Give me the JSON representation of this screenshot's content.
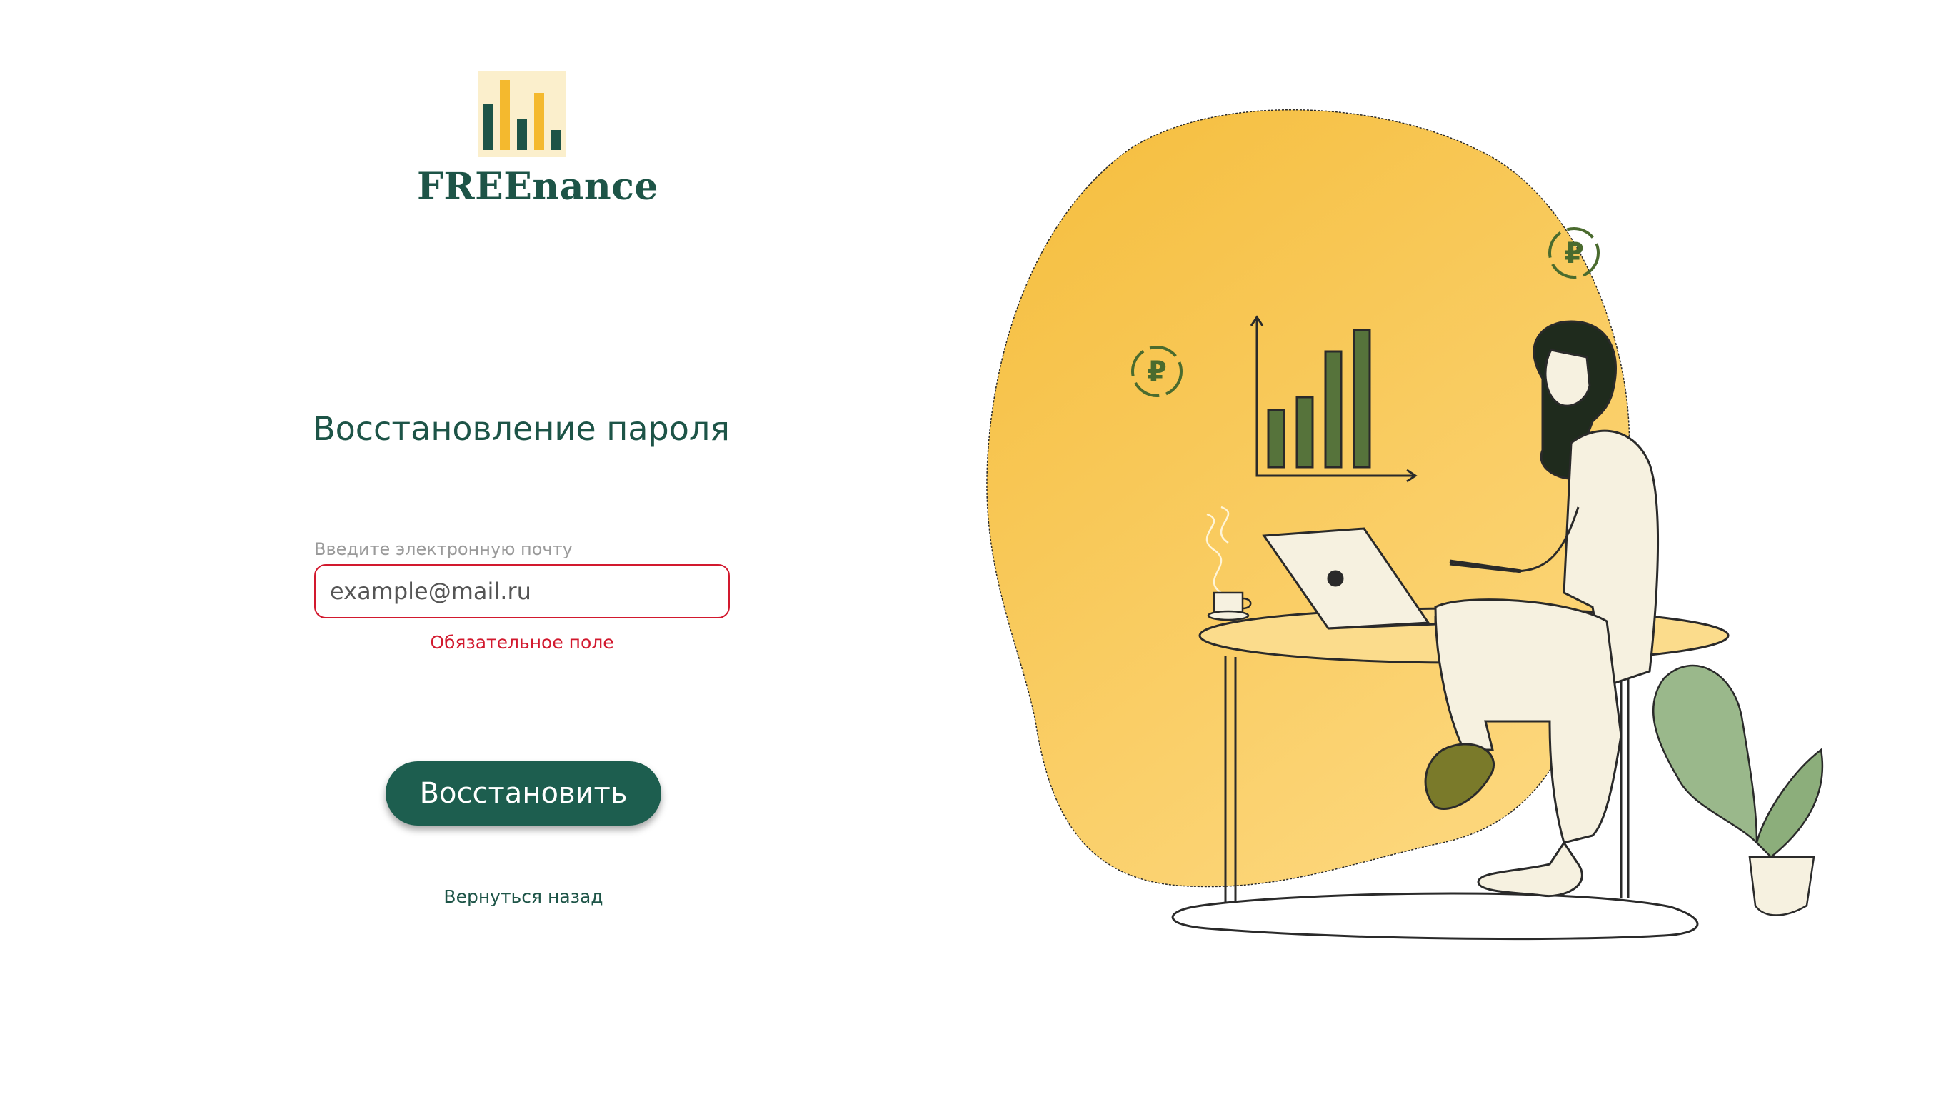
{
  "brand": {
    "name": "FREEnance",
    "colors": {
      "primary": "#1d5447",
      "accent": "#f4b92e",
      "logo_bg": "#fbefcc",
      "error": "#d2192e"
    }
  },
  "form": {
    "title": "Восстановление пароля",
    "email_label": "Введите электронную почту",
    "email_placeholder": "example@mail.ru",
    "email_value": "",
    "error_text": "Обязательное поле",
    "submit_label": "Восстановить",
    "back_link": "Вернуться назад"
  },
  "illustration": {
    "currency_symbol": "₽",
    "icons": [
      "ruble-coin-icon",
      "growth-chart-icon",
      "laptop-icon",
      "coffee-cup-icon",
      "potted-plant-icon"
    ]
  }
}
